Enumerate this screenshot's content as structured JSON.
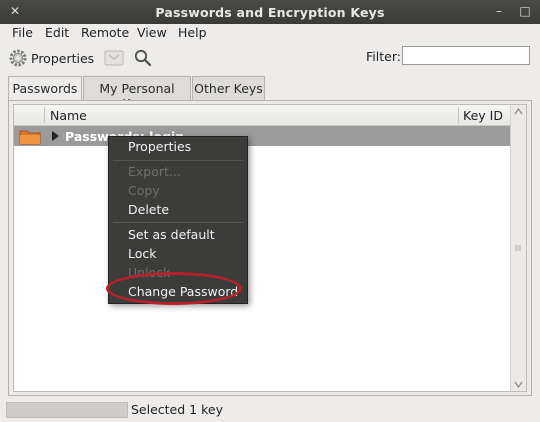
{
  "window": {
    "title": "Passwords and Encryption Keys"
  },
  "menubar": {
    "items": [
      "File",
      "Edit",
      "Remote",
      "View",
      "Help"
    ]
  },
  "toolbar": {
    "properties_label": "Properties",
    "filter_label": "Filter:",
    "filter_value": ""
  },
  "tabs": [
    "Passwords",
    "My Personal Keys",
    "Other Keys"
  ],
  "tree": {
    "columns": {
      "name": "Name",
      "keyid": "Key ID"
    },
    "rows": [
      {
        "label": "Passwords: login"
      }
    ]
  },
  "context_menu": {
    "items": [
      {
        "label": "Properties",
        "enabled": true
      },
      {
        "label": "Export...",
        "enabled": false
      },
      {
        "label": "Copy",
        "enabled": false
      },
      {
        "label": "Delete",
        "enabled": true
      },
      {
        "label": "Set as default",
        "enabled": true
      },
      {
        "label": "Lock",
        "enabled": true
      },
      {
        "label": "Unlock",
        "enabled": false
      },
      {
        "label": "Change Password",
        "enabled": true
      }
    ]
  },
  "status": {
    "text": "Selected 1 key"
  },
  "colors": {
    "selection": "#9b9b9b",
    "menu_bg": "#3c3c3a",
    "annotation_ring": "#b8202a"
  }
}
